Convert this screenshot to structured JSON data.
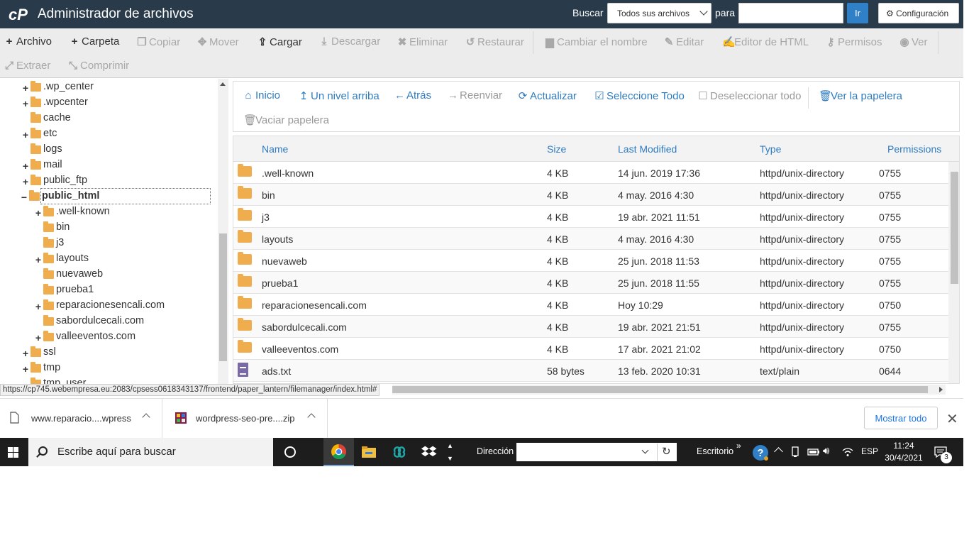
{
  "header": {
    "title": "Administrador de archivos",
    "search_label": "Buscar",
    "search_scope": "Todos sus archivos",
    "para_label": "para",
    "search_value": "",
    "go_label": "Ir",
    "config_label": "Configuración"
  },
  "toolbar": {
    "archivo": "Archivo",
    "carpeta": "Carpeta",
    "copiar": "Copiar",
    "mover": "Mover",
    "cargar": "Cargar",
    "descargar": "Descargar",
    "eliminar": "Eliminar",
    "restaurar": "Restaurar",
    "cambiar_nombre": "Cambiar el nombre",
    "editar": "Editar",
    "editor_html": "Editor de HTML",
    "permisos": "Permisos",
    "ver": "Ver",
    "extraer": "Extraer",
    "comprimir": "Comprimir"
  },
  "tree": {
    "items": [
      {
        "name": ".wp_center",
        "expandable": "+"
      },
      {
        "name": ".wpcenter",
        "expandable": "+"
      },
      {
        "name": "cache",
        "expandable": ""
      },
      {
        "name": "etc",
        "expandable": "+"
      },
      {
        "name": "logs",
        "expandable": ""
      },
      {
        "name": "mail",
        "expandable": "+"
      },
      {
        "name": "public_ftp",
        "expandable": "+"
      },
      {
        "name": "public_html",
        "expandable": "−"
      },
      {
        "name": ".well-known",
        "expandable": "+"
      },
      {
        "name": "bin",
        "expandable": ""
      },
      {
        "name": "j3",
        "expandable": ""
      },
      {
        "name": "layouts",
        "expandable": "+"
      },
      {
        "name": "nuevaweb",
        "expandable": ""
      },
      {
        "name": "prueba1",
        "expandable": ""
      },
      {
        "name": "reparacionesencali.com",
        "expandable": "+"
      },
      {
        "name": "sabordulcecali.com",
        "expandable": ""
      },
      {
        "name": "valleeventos.com",
        "expandable": "+"
      },
      {
        "name": "ssl",
        "expandable": "+"
      },
      {
        "name": "tmp",
        "expandable": "+"
      },
      {
        "name": "tmp_user",
        "expandable": ""
      }
    ]
  },
  "actions": {
    "inicio": "Inicio",
    "nivel_arriba": "Un nivel arriba",
    "atras": "Atrás",
    "reenviar": "Reenviar",
    "actualizar": "Actualizar",
    "seleccione_todo": "Seleccione Todo",
    "deseleccionar_todo": "Deseleccionar todo",
    "ver_papelera": "Ver la papelera",
    "vaciar_papelera": "Vaciar papelera"
  },
  "table": {
    "columns": {
      "name": "Name",
      "size": "Size",
      "modified": "Last Modified",
      "type": "Type",
      "permissions": "Permissions"
    },
    "rows": [
      {
        "name": ".well-known",
        "size": "4 KB",
        "modified": "14 jun. 2019 17:36",
        "type": "httpd/unix-directory",
        "perms": "0755"
      },
      {
        "name": "bin",
        "size": "4 KB",
        "modified": "4 may. 2016 4:30",
        "type": "httpd/unix-directory",
        "perms": "0755"
      },
      {
        "name": "j3",
        "size": "4 KB",
        "modified": "19 abr. 2021 11:51",
        "type": "httpd/unix-directory",
        "perms": "0755"
      },
      {
        "name": "layouts",
        "size": "4 KB",
        "modified": "4 may. 2016 4:30",
        "type": "httpd/unix-directory",
        "perms": "0755"
      },
      {
        "name": "nuevaweb",
        "size": "4 KB",
        "modified": "25 jun. 2018 11:53",
        "type": "httpd/unix-directory",
        "perms": "0755"
      },
      {
        "name": "prueba1",
        "size": "4 KB",
        "modified": "25 jun. 2018 11:55",
        "type": "httpd/unix-directory",
        "perms": "0755"
      },
      {
        "name": "reparacionesencali.com",
        "size": "4 KB",
        "modified": "Hoy 10:29",
        "type": "httpd/unix-directory",
        "perms": "0750"
      },
      {
        "name": "sabordulcecali.com",
        "size": "4 KB",
        "modified": "19 abr. 2021 21:51",
        "type": "httpd/unix-directory",
        "perms": "0755"
      },
      {
        "name": "valleeventos.com",
        "size": "4 KB",
        "modified": "17 abr. 2021 21:02",
        "type": "httpd/unix-directory",
        "perms": "0750"
      },
      {
        "name": "ads.txt",
        "size": "58 bytes",
        "modified": "13 feb. 2020 10:31",
        "type": "text/plain",
        "perms": "0644"
      }
    ]
  },
  "status_url": "https://cp745.webempresa.eu:2083/cpsess0618343137/frontend/paper_lantern/filemanager/index.html#",
  "downloads": {
    "item1": "www.reparacio....wpress",
    "item2": "wordpress-seo-pre....zip",
    "show_all": "Mostrar todo"
  },
  "taskbar": {
    "search_placeholder": "Escribe aquí para buscar",
    "address_label": "Dirección",
    "desktop_label": "Escritorio",
    "language": "ESP",
    "time": "11:24",
    "date": "30/4/2021",
    "notifications": "3"
  },
  "colors": {
    "header_bg": "#293a4a",
    "accent": "#2f7bc0",
    "folder": "#f0ad4e"
  }
}
